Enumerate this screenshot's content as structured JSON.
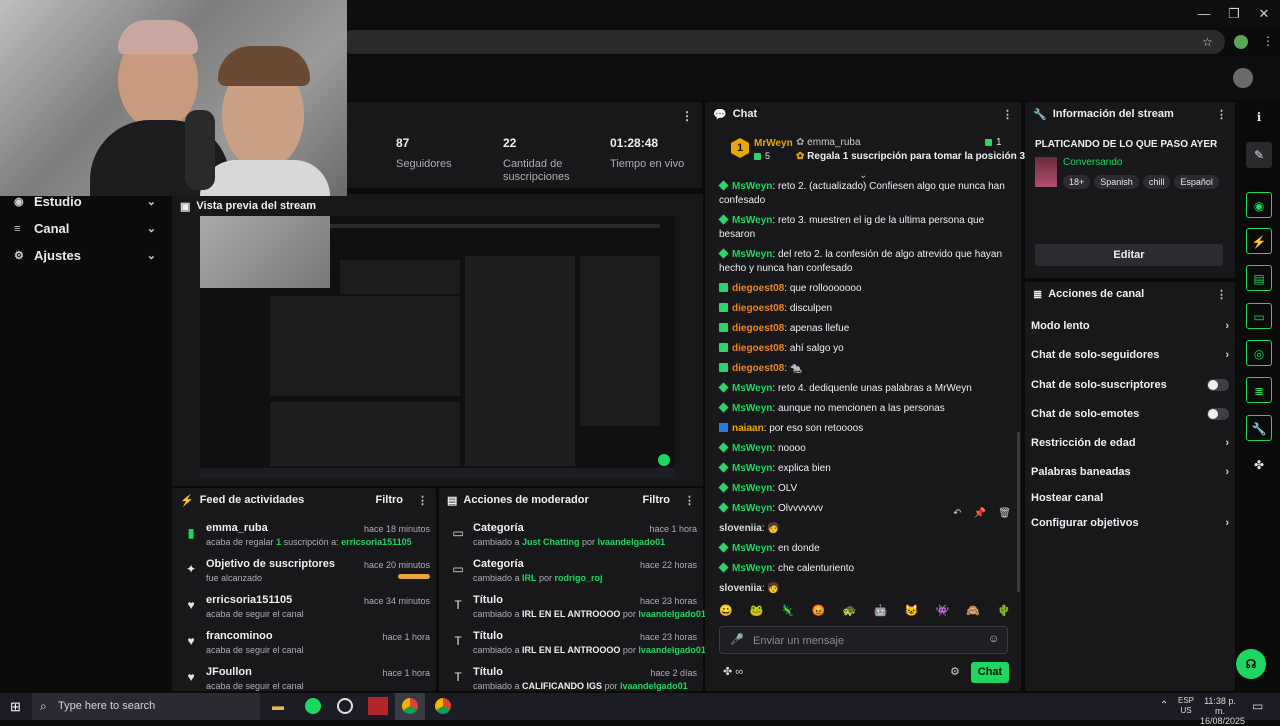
{
  "window": {
    "minimize": "—",
    "restore": "❐",
    "close": "✕"
  },
  "stats": [
    {
      "num": "",
      "lbl": "s"
    },
    {
      "num": "87",
      "lbl": "Seguidores"
    },
    {
      "num": "22",
      "lbl": "Cantidad de suscripciones"
    },
    {
      "num": "01:28:48",
      "lbl": "Tiempo en vivo"
    }
  ],
  "sidebar": {
    "items": [
      {
        "label": "Estudio"
      },
      {
        "label": "Canal"
      },
      {
        "label": "Ajustes"
      }
    ]
  },
  "preview": {
    "title": "Vista previa del stream"
  },
  "feed": {
    "title": "Feed de actividades",
    "filter": "Filtro",
    "rows": [
      {
        "title": "emma_ruba",
        "time": "hace 18 minutos",
        "sub_pre": "acaba de regalar ",
        "sub_num": "1",
        "sub_mid": " suscripción a: ",
        "sub_user": "erricsoria151105"
      },
      {
        "title": "Objetivo de suscriptores",
        "time": "hace 20 minutos",
        "sub_pre": "fue alcanzado",
        "sub_num": "",
        "sub_mid": "",
        "sub_user": ""
      },
      {
        "title": "erricsoria151105",
        "time": "hace 34 minutos",
        "sub_pre": "acaba de seguir el canal",
        "sub_num": "",
        "sub_mid": "",
        "sub_user": ""
      },
      {
        "title": "francominoo",
        "time": "hace 1 hora",
        "sub_pre": "acaba de seguir el canal",
        "sub_num": "",
        "sub_mid": "",
        "sub_user": ""
      },
      {
        "title": "JFoullon",
        "time": "hace 1 hora",
        "sub_pre": "acaba de seguir el canal",
        "sub_num": "",
        "sub_mid": "",
        "sub_user": ""
      }
    ]
  },
  "mod": {
    "title": "Acciones de moderador",
    "filter": "Filtro",
    "rows": [
      {
        "title": "Categoría",
        "time": "hace 1 hora",
        "pre": "cambiado a ",
        "val": "Just Chatting",
        "by": " por ",
        "user": "lvaandelgado01"
      },
      {
        "title": "Categoría",
        "time": "hace 22 horas",
        "pre": "cambiado a ",
        "val": "IRL",
        "by": " por ",
        "user": "rodrigo_roj"
      },
      {
        "title": "Título",
        "time": "hace 23 horas",
        "pre": "cambiado a ",
        "val": "IRL EN EL ANTROOOO",
        "by": " por ",
        "user": "lvaandelgado01"
      },
      {
        "title": "Título",
        "time": "hace 23 horas",
        "pre": "cambiado a ",
        "val": "IRL EN EL ANTROOOO",
        "by": " por ",
        "user": "lvaandelgado01"
      },
      {
        "title": "Título",
        "time": "hace 2 días",
        "pre": "cambiado a ",
        "val": "CALIFICANDO IGS",
        "by": " por ",
        "user": "lvaandelgado01"
      }
    ]
  },
  "chat": {
    "title": "Chat",
    "pin": {
      "rank": "1",
      "user": "MrWeyn",
      "user_count": "5",
      "gifter": "emma_ruba",
      "gift_count": "1",
      "text": "Regala 1 suscripción para tomar la posición 3"
    },
    "messages": [
      {
        "user": "MsWeyn",
        "cls": "u-ms",
        "badge": "b-diamond",
        "text": "reto 2. (actualizado) Confiesen algo que nunca han confesado"
      },
      {
        "user": "MsWeyn",
        "cls": "u-ms",
        "badge": "b-diamond",
        "text": "reto 3. muestren el ig de la ultima persona que besaron"
      },
      {
        "user": "MsWeyn",
        "cls": "u-ms",
        "badge": "b-diamond",
        "text": "del reto 2. la confesión de algo atrevido que hayan hecho y nunca han confesado"
      },
      {
        "user": "diegoest08",
        "cls": "u-die",
        "badge": "b-sq",
        "text": "que rollooooooo"
      },
      {
        "user": "diegoest08",
        "cls": "u-die",
        "badge": "b-sq",
        "text": "disculpen"
      },
      {
        "user": "diegoest08",
        "cls": "u-die",
        "badge": "b-sq",
        "text": "apenas llefue"
      },
      {
        "user": "diegoest08",
        "cls": "u-die",
        "badge": "b-sq",
        "text": "ahí salgo yo"
      },
      {
        "user": "diegoest08",
        "cls": "u-die",
        "badge": "b-sq",
        "text": "🐀"
      },
      {
        "user": "MsWeyn",
        "cls": "u-ms",
        "badge": "b-diamond",
        "text": "reto 4. dediquenle unas palabras a MrWeyn"
      },
      {
        "user": "MsWeyn",
        "cls": "u-ms",
        "badge": "b-diamond",
        "text": "aunque no mencionen a las personas"
      },
      {
        "user": "naiaan",
        "cls": "u-nai",
        "badge": "b-blue",
        "text": "por eso son retoooos"
      },
      {
        "user": "MsWeyn",
        "cls": "u-ms",
        "badge": "b-diamond",
        "text": "noooo"
      },
      {
        "user": "MsWeyn",
        "cls": "u-ms",
        "badge": "b-diamond",
        "text": "explica bien"
      },
      {
        "user": "MsWeyn",
        "cls": "u-ms",
        "badge": "b-diamond",
        "text": "OLV"
      },
      {
        "user": "MsWeyn",
        "cls": "u-ms",
        "badge": "b-diamond",
        "text": "Olvvvvvvv"
      },
      {
        "user": "sloveniia",
        "cls": "u-slo",
        "badge": "",
        "text": "🧑"
      },
      {
        "user": "MsWeyn",
        "cls": "u-ms",
        "badge": "b-diamond",
        "text": "en donde"
      },
      {
        "user": "MsWeyn",
        "cls": "u-ms",
        "badge": "b-diamond",
        "text": "che calenturiento"
      },
      {
        "user": "sloveniia",
        "cls": "u-slo",
        "badge": "",
        "text": "🧑"
      }
    ],
    "input_placeholder": "Enviar un mensaje",
    "send": "Chat",
    "emotes": [
      "😀",
      "🐸",
      "🦎",
      "😡",
      "🐢",
      "🤖",
      "😺",
      "👾",
      "🙈",
      "🌵"
    ],
    "points": "∞"
  },
  "info": {
    "title": "Información del stream",
    "stream_title": "PLATICANDO DE LO QUE PASO AYER",
    "category": "Conversando",
    "tags": [
      "18+",
      "Spanish",
      "chill",
      "Español"
    ],
    "edit": "Editar"
  },
  "actions": {
    "title": "Acciones de canal",
    "items": [
      {
        "label": "Modo lento",
        "kind": "chev"
      },
      {
        "label": "Chat de solo-seguidores",
        "kind": "chev"
      },
      {
        "label": "Chat de solo-suscriptores",
        "kind": "toggle"
      },
      {
        "label": "Chat de solo-emotes",
        "kind": "toggle"
      },
      {
        "label": "Restricción de edad",
        "kind": "chev"
      },
      {
        "label": "Palabras baneadas",
        "kind": "chev"
      },
      {
        "label": "Hostear canal",
        "kind": "none"
      },
      {
        "label": "Configurar objetivos",
        "kind": "chev"
      }
    ]
  },
  "taskbar": {
    "search": "Type here to search",
    "lang1": "ESP",
    "lang2": "US",
    "time": "11:38 p. m.",
    "date": "16/08/2025"
  },
  "colors": {
    "accent": "#1ed760",
    "panel": "#18181b",
    "bg": "#0b0b0c"
  }
}
